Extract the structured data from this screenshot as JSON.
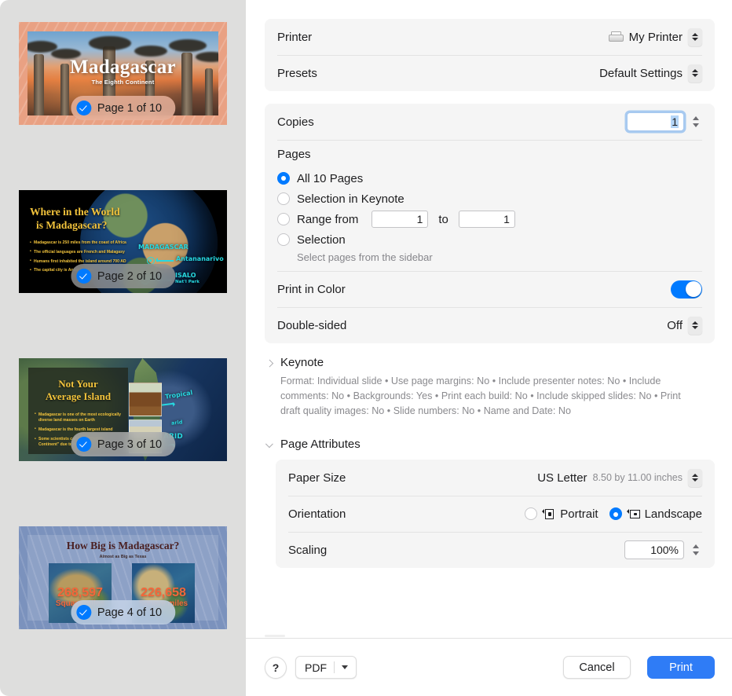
{
  "sidebar": {
    "pages": [
      {
        "badge_label": "Page 1 of 10",
        "selected": true,
        "badge_tint": "rgba(236,182,160,0.82)",
        "slide": {
          "title": "Madagascar",
          "subtitle": "The Eighth Continent"
        }
      },
      {
        "badge_label": "Page 2 of 10",
        "selected": true,
        "badge_tint": "rgba(150,150,150,0.80)",
        "slide": {
          "title_line1": "Where in the World",
          "title_line2": "is Madagascar?",
          "bullets": [
            "Madagascar is 250 miles from the coast of Africa",
            "The official languages are French and Malagasy",
            "Humans first inhabited the island around 700 AD",
            "The capital city is Antananarivo"
          ],
          "annotations": [
            "MADAGASCAR",
            "Antananarivo",
            "ISALO",
            "Nat'l Park"
          ]
        }
      },
      {
        "badge_label": "Page 3 of 10",
        "selected": true,
        "badge_tint": "rgba(176,176,176,0.80)",
        "slide": {
          "title_line1": "Not Your",
          "title_line2": "Average Island",
          "bullets": [
            "Madagascar is one of the most ecologically diverse land masses on Earth",
            "Madagascar is the fourth largest island",
            "Some scientists call it the \"Eighth Continent\" due to its biodiversity"
          ],
          "annotations": [
            "Tropical",
            "arid",
            "ARID"
          ]
        }
      },
      {
        "badge_label": "Page 4 of 10",
        "selected": true,
        "badge_tint": "rgba(198,211,232,0.85)",
        "slide": {
          "title": "How Big is Madagascar?",
          "subtitle": "Almost as Big as Texas",
          "left_number": "268,597",
          "left_unit": "Square miles",
          "right_number": "226,658",
          "right_unit": "Square miles"
        }
      }
    ]
  },
  "printer_group": {
    "printer_label": "Printer",
    "printer_value": "My Printer",
    "presets_label": "Presets",
    "presets_value": "Default Settings"
  },
  "options_group": {
    "copies_label": "Copies",
    "copies_value": "1",
    "pages_label": "Pages",
    "radios": [
      {
        "label": "All 10 Pages",
        "selected": true
      },
      {
        "label": "Selection in Keynote",
        "selected": false
      },
      {
        "label": "Range from",
        "selected": false
      },
      {
        "label": "Selection",
        "selected": false
      }
    ],
    "range_from_value": "1",
    "range_to_label": "to",
    "range_to_value": "1",
    "selection_hint": "Select pages from the sidebar",
    "print_in_color_label": "Print in Color",
    "print_in_color_on": true,
    "double_sided_label": "Double-sided",
    "double_sided_value": "Off"
  },
  "keynote_section": {
    "title": "Keynote",
    "expanded": false,
    "summary": "Format: Individual slide • Use page margins: No • Include presenter notes: No • Include comments: No • Backgrounds: Yes • Print each build: No • Include skipped slides: No • Print draft quality images: No • Slide numbers: No • Name and Date: No"
  },
  "page_attributes_section": {
    "title": "Page Attributes",
    "expanded": true,
    "paper_size_label": "Paper Size",
    "paper_size_value": "US Letter",
    "paper_size_detail": "8.50 by 11.00 inches",
    "orientation_label": "Orientation",
    "orientation_options": [
      {
        "label": "Portrait",
        "selected": false
      },
      {
        "label": "Landscape",
        "selected": true
      }
    ],
    "scaling_label": "Scaling",
    "scaling_value": "100%"
  },
  "bottom_bar": {
    "help_label": "?",
    "pdf_label": "PDF",
    "cancel_label": "Cancel",
    "print_label": "Print"
  },
  "colors": {
    "accent_blue": "#007aff",
    "print_button_blue": "#2f7cf6",
    "group_background": "#f5f5f5",
    "sidebar_background": "#dededd"
  }
}
